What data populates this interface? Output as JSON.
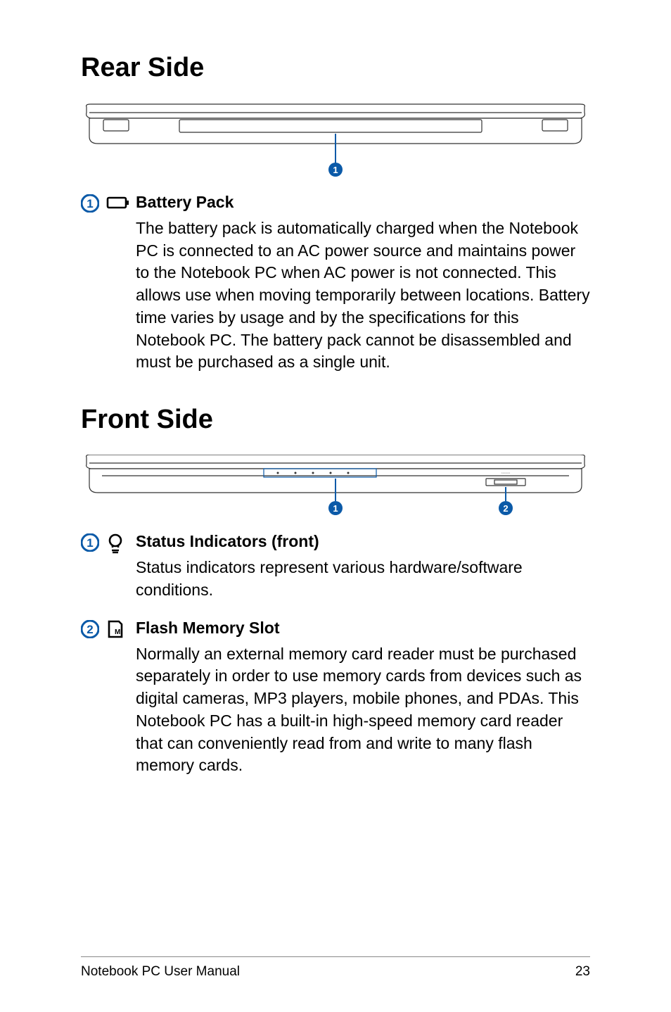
{
  "sections": {
    "rear": {
      "title": "Rear Side",
      "items": [
        {
          "badge": "1",
          "heading": "Battery Pack",
          "body": "The battery pack is automatically charged when the Notebook PC is connected to an AC power source and maintains power to the Notebook PC when AC power is not connected. This allows use when moving temporarily between locations. Battery time varies by usage and by the specifications for this Notebook PC. The battery pack cannot be disassembled and must be purchased as a single unit."
        }
      ]
    },
    "front": {
      "title": "Front Side",
      "items": [
        {
          "badge": "1",
          "heading": "Status Indicators (front)",
          "body": "Status indicators represent various hardware/software conditions."
        },
        {
          "badge": "2",
          "heading": "Flash Memory Slot",
          "body": "Normally an external memory card reader must be purchased separately in order to use memory cards from devices such as digital cameras, MP3 players, mobile phones, and PDAs. This Notebook PC has a built-in high-speed memory card reader that can conveniently read from and write to many flash memory cards."
        }
      ]
    }
  },
  "diagram_callouts": {
    "rear": [
      "1"
    ],
    "front": [
      "1",
      "2"
    ]
  },
  "footer": {
    "left": "Notebook PC User Manual",
    "right": "23"
  }
}
